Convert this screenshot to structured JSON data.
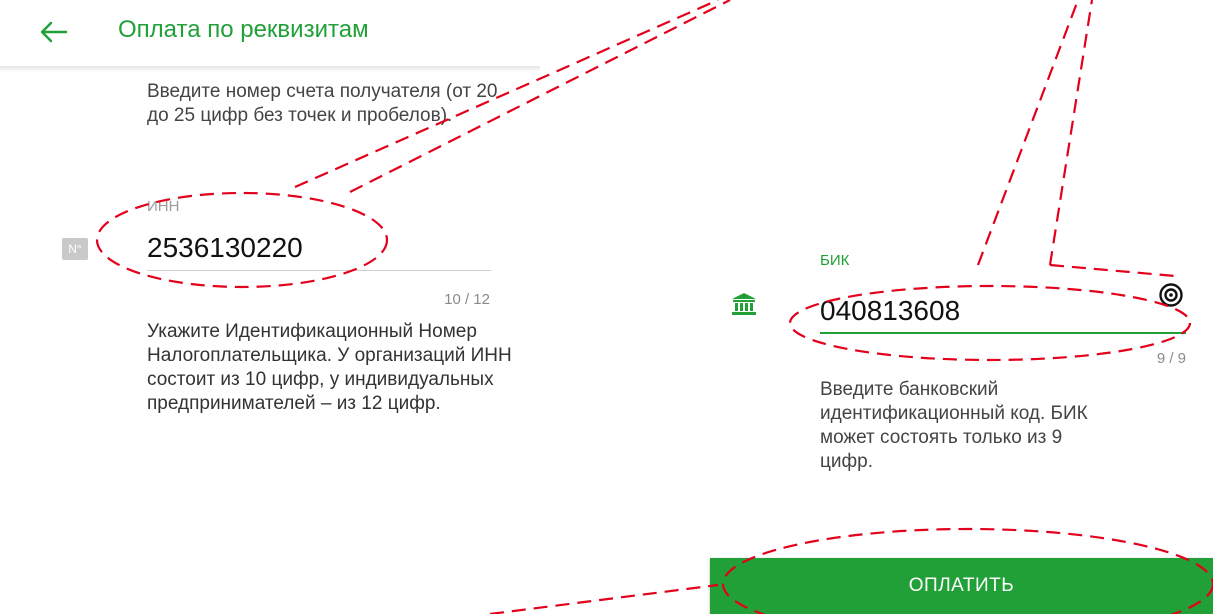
{
  "header": {
    "back_icon": "arrow-left-icon",
    "title": "Оплата по реквизитам"
  },
  "account_field": {
    "help_text": "Введите номер счета получателя (от 20 до 25 цифр без точек и пробелов)."
  },
  "inn_field": {
    "label": "ИНН",
    "icon_text": "N°",
    "value": "2536130220",
    "counter": "10 / 12",
    "help_text": "Укажите Идентификационный Номер Налогоплательщика. У организаций ИНН состоит из 10 цифр, у индивидуальных предпринимателей – из 12 цифр."
  },
  "bik_field": {
    "label": "БИК",
    "icon": "bank-icon",
    "value": "040813608",
    "scan_icon": "target-icon",
    "counter": "9 / 9",
    "help_text": "Введите банковский идентификационный код. БИК может состоять только из 9 цифр."
  },
  "pay_button": {
    "label": "ОПЛАТИТЬ"
  },
  "colors": {
    "accent": "#21a038",
    "annotation": "#e3001b"
  }
}
